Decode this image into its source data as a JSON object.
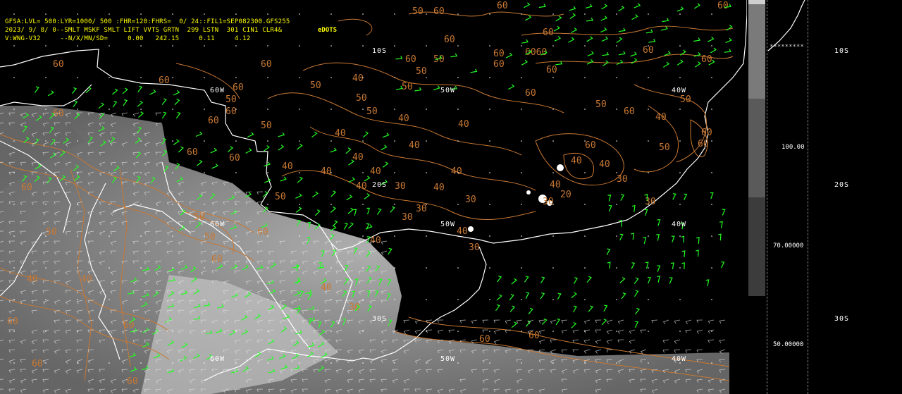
{
  "header": {
    "line1": "GFSA:LVL= 500:LYR=1000/ 500 :FHR=120:FHRS=  0/ 24::FIL1=SEP082300.GFS255",
    "line2": "2023/ 9/ 8/ 0--SMLT MSKF SMLT LIFT VVTS GRTN  299 LSTN  301 CIN1 CLR4&",
    "line3": "V:WNG-V32     --N/X/MN/SD=     0.00   242.15     0.11     4.12",
    "dots_label": "eDOTS"
  },
  "map_grid_labels": {
    "lat_10s": "10S",
    "lat_20s": "20S",
    "lat_30s": "30S",
    "lon_60w_a": "60W",
    "lon_50w_a": "50W",
    "lon_40w_a": "40W",
    "lon_60w_b": "60W",
    "lon_50w_b": "50W",
    "lon_40w_b": "40W",
    "lon_60w_c": "60W",
    "lon_50w_c": "50W",
    "lon_40w_c": "40W"
  },
  "contour_labels": [
    "60",
    "50",
    "40",
    "30",
    "20"
  ],
  "right_panel": {
    "lat_10s": "10S",
    "lat_20s": "20S",
    "lat_30s": "30S",
    "scale_100": "100.00",
    "scale_70": "70.00000",
    "scale_50": "50.00000",
    "stars": "*********"
  },
  "colors": {
    "contour": "#c87833",
    "wind": "#22ff22",
    "coast": "#ffffff",
    "header": "#ffff00",
    "cloud_gray": "#9a9a9a"
  }
}
